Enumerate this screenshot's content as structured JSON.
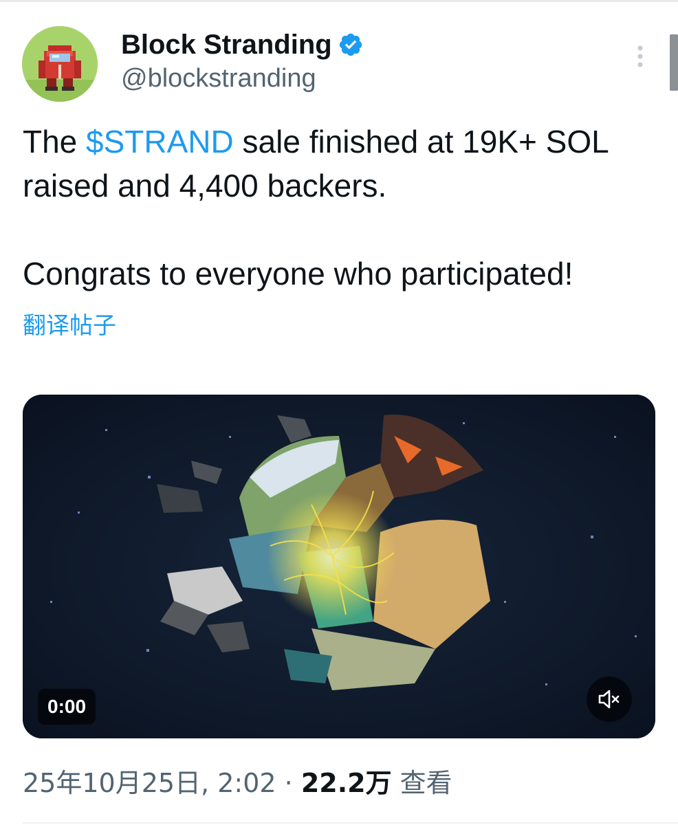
{
  "tweet": {
    "author": {
      "display_name": "Block Stranding",
      "handle": "@blockstranding",
      "verified": true,
      "avatar_icon": "red-hooded-pixel-character-icon",
      "verified_color": "#1d9bf0"
    },
    "more_icon": "more-vertical-icon",
    "text": {
      "line1_before": "The ",
      "cashtag": "$STRAND",
      "line1_after": " sale finished at 19K+ SOL raised and 4,400 backers.",
      "line2": "Congrats to everyone who participated!"
    },
    "translate_label": "翻译帖子",
    "media": {
      "type": "video",
      "time": "0:00",
      "mute_icon": "volume-muted-icon"
    },
    "meta": {
      "timestamp": "25年10月25日, 2:02",
      "separator": " · ",
      "views_count": "22.2万",
      "views_label": "查看"
    }
  },
  "colors": {
    "accent": "#1d9bf0",
    "text_primary": "#0f1419",
    "text_secondary": "#536471"
  }
}
